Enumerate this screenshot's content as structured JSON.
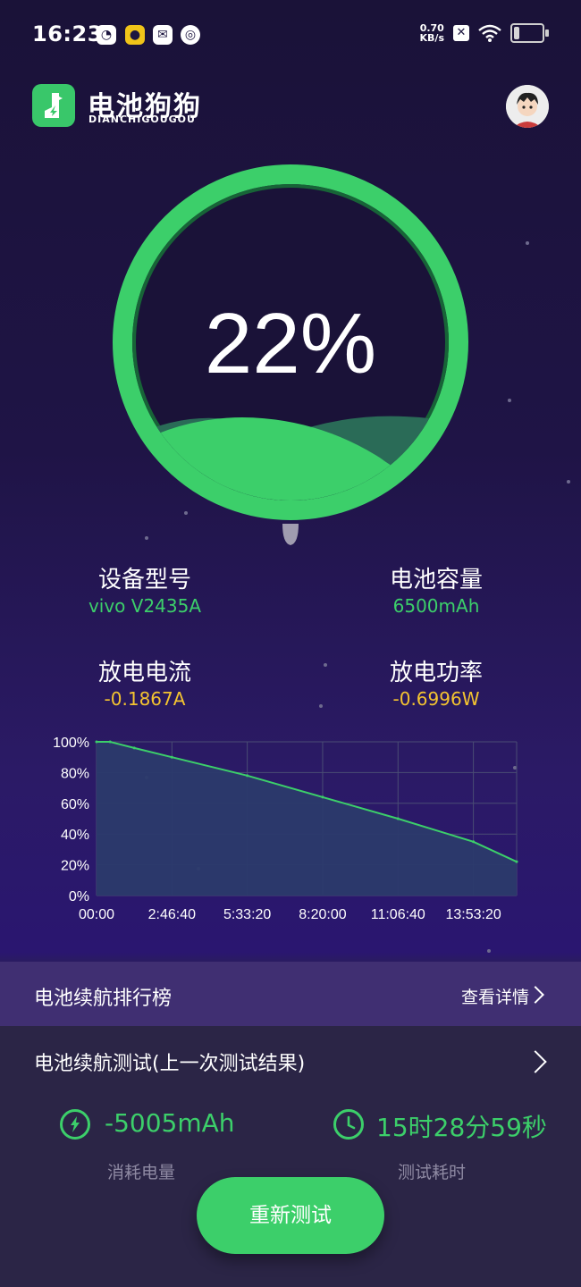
{
  "status_bar": {
    "time": "16:23",
    "net_speed_value": "0.70",
    "net_speed_unit": "KB/s"
  },
  "app": {
    "name": "电池狗狗",
    "subtitle": "DIANCHIGOUGOU"
  },
  "battery": {
    "percent_text": "22%",
    "level": 0.22
  },
  "stats": {
    "device_model_label": "设备型号",
    "device_model_value": "vivo V2435A",
    "capacity_label": "电池容量",
    "capacity_value": "6500mAh",
    "current_label": "放电电流",
    "current_value": "-0.1867A",
    "power_label": "放电功率",
    "power_value": "-0.6996W"
  },
  "chart_data": {
    "type": "area",
    "x_tick_labels": [
      "00:00",
      "2:46:40",
      "5:33:20",
      "8:20:00",
      "11:06:40",
      "13:53:20"
    ],
    "y_tick_labels": [
      "100%",
      "80%",
      "60%",
      "40%",
      "20%",
      "0%"
    ],
    "ylim": [
      0,
      100
    ],
    "x_seconds": [
      0,
      1800,
      5000,
      10000,
      20000,
      30000,
      40000,
      50000,
      55739
    ],
    "y_percent": [
      100,
      100,
      96,
      90,
      78,
      64,
      50,
      35,
      22
    ],
    "grid": true,
    "color": "#3ccf6a"
  },
  "ranking": {
    "title": "电池续航排行榜",
    "link": "查看详情"
  },
  "test": {
    "title": "电池续航测试(上一次测试结果)",
    "consumed_value": "-5005mAh",
    "consumed_label": "消耗电量",
    "duration_value": "15时28分59秒",
    "duration_label": "测试耗时",
    "retest_button": "重新测试"
  },
  "colors": {
    "accent": "#3ccf6a",
    "warning": "#f4c430",
    "background": "#1f1446"
  },
  "icons": [
    "app-logo-icon",
    "avatar-icon",
    "wifi-icon",
    "battery-icon",
    "bolt-icon",
    "clock-icon",
    "chevron-right-icon"
  ]
}
